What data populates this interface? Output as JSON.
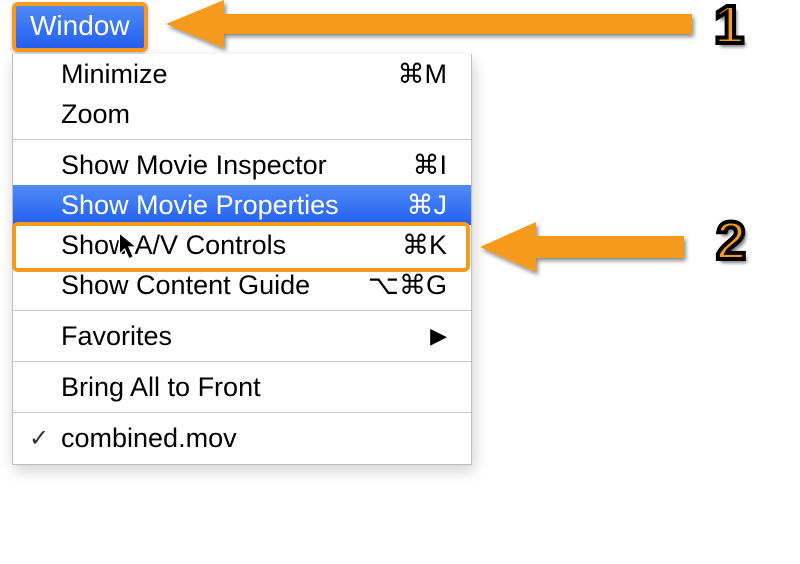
{
  "menu_title": "Window",
  "items": [
    {
      "label": "Minimize",
      "shortcut": "⌘M",
      "checked": false,
      "highlighted": false,
      "has_submenu": false
    },
    {
      "label": "Zoom",
      "shortcut": "",
      "checked": false,
      "highlighted": false,
      "has_submenu": false
    },
    {
      "separator": true
    },
    {
      "label": "Show Movie Inspector",
      "shortcut": "⌘I",
      "checked": false,
      "highlighted": false,
      "has_submenu": false
    },
    {
      "label": "Show Movie Properties",
      "shortcut": "⌘J",
      "checked": false,
      "highlighted": true,
      "has_submenu": false
    },
    {
      "label": "Show A/V Controls",
      "shortcut": "⌘K",
      "checked": false,
      "highlighted": false,
      "has_submenu": false
    },
    {
      "label": "Show Content Guide",
      "shortcut": "⌥⌘G",
      "checked": false,
      "highlighted": false,
      "has_submenu": false
    },
    {
      "separator": true
    },
    {
      "label": "Favorites",
      "shortcut": "",
      "checked": false,
      "highlighted": false,
      "has_submenu": true
    },
    {
      "separator": true
    },
    {
      "label": "Bring All to Front",
      "shortcut": "",
      "checked": false,
      "highlighted": false,
      "has_submenu": false
    },
    {
      "separator": true
    },
    {
      "label": "combined.mov",
      "shortcut": "",
      "checked": true,
      "highlighted": false,
      "has_submenu": false
    }
  ],
  "annotations": {
    "badge1": "1",
    "badge2": "2"
  },
  "colors": {
    "orange": "#f59a1d",
    "highlight_blue_top": "#4f8bf5",
    "highlight_blue_bottom": "#245ff0"
  }
}
